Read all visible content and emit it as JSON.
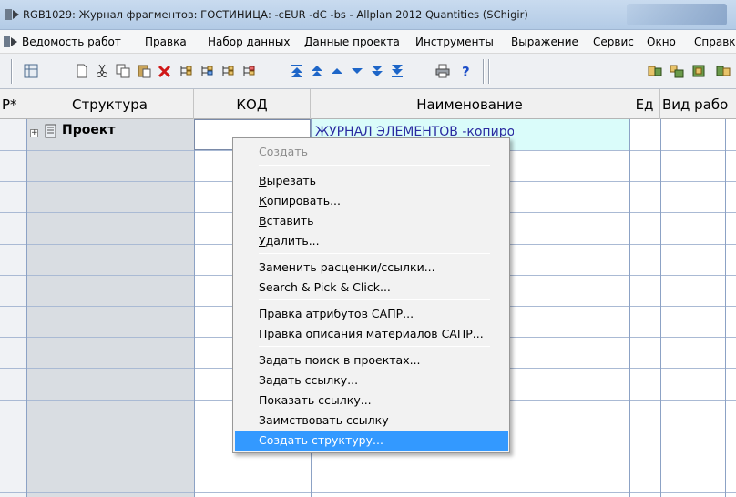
{
  "window": {
    "title": "RGB1029: Журнал фрагментов: ГОСТИНИЦА: -cEUR -dC -bs - Allplan 2012 Quantities (SChigir)"
  },
  "menubar": {
    "items": [
      "Ведомость работ",
      "Правка",
      "Набор данных",
      "Данные проекта",
      "Инструменты",
      "Выражение",
      "Сервис",
      "Окно",
      "Справк"
    ]
  },
  "toolbar": {
    "icons": [
      "grid-icon",
      "new-document-icon",
      "cut-icon",
      "copy-icon",
      "paste-icon",
      "delete-icon",
      "tree-icon-1",
      "tree-icon-2",
      "tree-icon-3",
      "tree-icon-4",
      "move-top-icon",
      "move-up-icon",
      "up-icon",
      "down-icon",
      "move-down-icon",
      "move-bottom-icon",
      "print-icon",
      "help-icon",
      "tool-icon-1",
      "tool-icon-2",
      "tool-icon-3",
      "tool-icon-4"
    ]
  },
  "grid": {
    "columns": [
      "Р*",
      "Структура",
      "КОД",
      "Наименование",
      "Ед",
      "Вид рабо"
    ],
    "row": {
      "structure": "Проект",
      "code": "",
      "name": "ЖУРНАЛ ЭЛЕМЕНТОВ -копировать-"
    }
  },
  "context_menu": {
    "items": [
      {
        "label_u": "С",
        "label_rest": "оздать",
        "disabled": true
      },
      {
        "label_u": "В",
        "label_rest": "ырезать",
        "disabled": false
      },
      {
        "label_u": "К",
        "label_rest": "опировать...",
        "disabled": false
      },
      {
        "label_u": "В",
        "label_rest": "ставить",
        "disabled": false
      },
      {
        "label_u": "У",
        "label_rest": "далить...",
        "disabled": false
      },
      {
        "label_u": "",
        "label_rest": "Заменить расценки/ссылки...",
        "disabled": false
      },
      {
        "label_u": "",
        "label_rest": "Search & Pick & Click...",
        "disabled": false
      },
      {
        "label_u": "",
        "label_rest": "Правка атрибутов САПР...",
        "disabled": false
      },
      {
        "label_u": "",
        "label_rest": "Правка описания материалов САПР...",
        "disabled": false
      },
      {
        "label_u": "",
        "label_rest": "Задать поиск в проектах...",
        "disabled": false
      },
      {
        "label_u": "",
        "label_rest": "Задать ссылку...",
        "disabled": false
      },
      {
        "label_u": "",
        "label_rest": "Показать ссылку...",
        "disabled": false
      },
      {
        "label_u": "",
        "label_rest": "Заимствовать ссылку",
        "disabled": false
      },
      {
        "label_u": "",
        "label_rest": "Создать структуру...",
        "disabled": false,
        "highlighted": true
      }
    ]
  },
  "colors": {
    "highlight": "#3399ff",
    "name_cell_bg": "#dafcfa",
    "structure_col_bg": "#d9dde2",
    "name_text": "#2a2aa0"
  }
}
